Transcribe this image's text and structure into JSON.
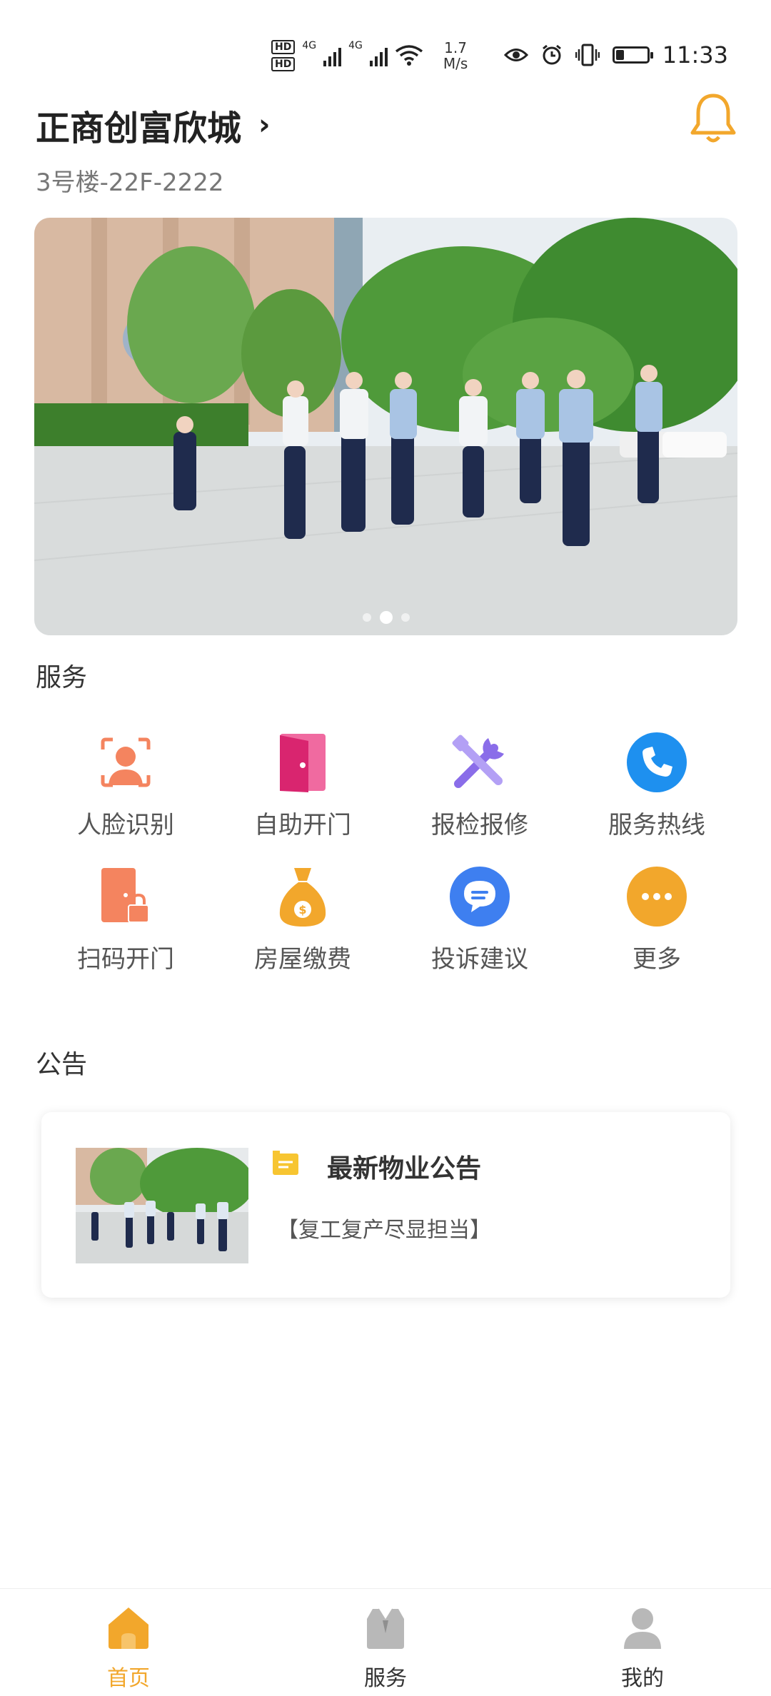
{
  "status_bar": {
    "hd1": "HD",
    "hd2": "HD",
    "net1": "4G",
    "net2": "4G",
    "speed_value": "1.7",
    "speed_unit": "M/s",
    "time": "11:33",
    "battery_level": 0.25
  },
  "header": {
    "community": "正商创富欣城",
    "address": "3号楼-22F-2222"
  },
  "banner": {
    "slides_count": 3,
    "active_slide": 1
  },
  "services": {
    "title": "服务",
    "items": [
      {
        "label": "人脸识别",
        "icon": "face-scan-icon",
        "color": "#f4845f"
      },
      {
        "label": "自助开门",
        "icon": "door-icon",
        "color": "#e33a86"
      },
      {
        "label": "报检报修",
        "icon": "tools-icon",
        "color": "#8a6de9"
      },
      {
        "label": "服务热线",
        "icon": "phone-icon",
        "color": "#1e90ef"
      },
      {
        "label": "扫码开门",
        "icon": "door-lock-icon",
        "color": "#f4845f"
      },
      {
        "label": "房屋缴费",
        "icon": "money-bag-icon",
        "color": "#f2a72c"
      },
      {
        "label": "投诉建议",
        "icon": "chat-bubble-icon",
        "color": "#3e7ff0"
      },
      {
        "label": "更多",
        "icon": "more-icon",
        "color": "#f2a72c"
      }
    ]
  },
  "notice": {
    "section_title": "公告",
    "title": "最新物业公告",
    "subtitle": "【复工复产尽显担当】"
  },
  "tabbar": {
    "items": [
      {
        "label": "首页",
        "icon": "home-icon",
        "active": true
      },
      {
        "label": "服务",
        "icon": "service-icon",
        "active": false
      },
      {
        "label": "我的",
        "icon": "user-icon",
        "active": false
      }
    ],
    "active_color": "#f2a72c"
  }
}
